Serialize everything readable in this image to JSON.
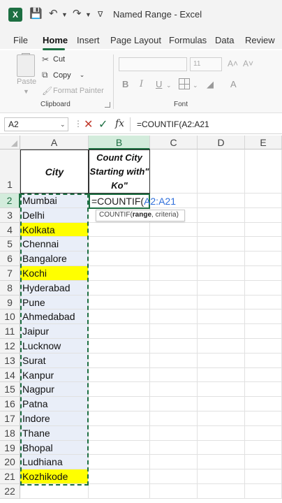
{
  "titlebar": {
    "logo_letter": "X",
    "title": "Named Range  -  Excel"
  },
  "menu": [
    "File",
    "Home",
    "Insert",
    "Page Layout",
    "Formulas",
    "Data",
    "Review"
  ],
  "ribbon": {
    "paste_label": "Paste",
    "cut_label": "Cut",
    "copy_label": "Copy",
    "format_painter_label": "Format Painter",
    "clipboard_group": "Clipboard",
    "font_group": "Font",
    "font_size": "11",
    "bold": "B",
    "italic": "I",
    "underline": "U"
  },
  "formula_bar": {
    "name_box": "A2",
    "fx": "fx",
    "formula": "=COUNTIF(A2:A21"
  },
  "columns": [
    "A",
    "B",
    "C",
    "D",
    "E"
  ],
  "rows": [
    "1",
    "2",
    "3",
    "4",
    "5",
    "6",
    "7",
    "8",
    "9",
    "10",
    "11",
    "12",
    "13",
    "14",
    "15",
    "16",
    "17",
    "18",
    "19",
    "20",
    "21",
    "22"
  ],
  "sheet": {
    "header_city": "City",
    "header_count": "Count City Starting with\" Ko\"",
    "cities": [
      "Mumbai",
      "Delhi",
      "Kolkata",
      "Chennai",
      "Bangalore",
      "Kochi",
      "Hyderabad",
      "Pune",
      "Ahmedabad",
      "Jaipur",
      "Lucknow",
      "Surat",
      "Kanpur",
      "Nagpur",
      "Patna",
      "Indore",
      "Thane",
      "Bhopal",
      "Ludhiana",
      "Kozhikode"
    ],
    "highlighted": [
      "Kolkata",
      "Kochi",
      "Kozhikode"
    ],
    "highlight_color": "#ffff00",
    "range_color": "#e9eef8",
    "edit_prefix": "=COUNTIF(",
    "edit_ref": "A2:A21",
    "tooltip_fn": "COUNTIF(",
    "tooltip_arg1": "range",
    "tooltip_rest": ", criteria)"
  },
  "colors": {
    "accent": "#1d6f42",
    "ref_blue": "#2f6fdb"
  }
}
